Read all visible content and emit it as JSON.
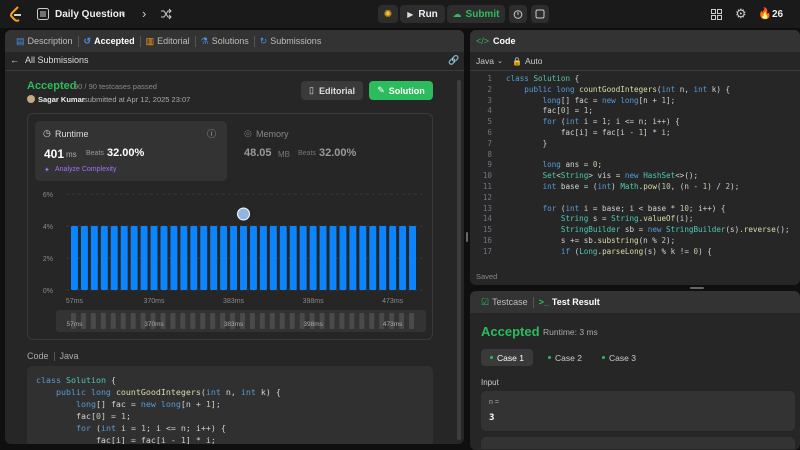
{
  "nav": {
    "title": "Daily Question",
    "run": "Run",
    "submit": "Submit",
    "streak": "26"
  },
  "left": {
    "tabs": [
      "Description",
      "Accepted",
      "Editorial",
      "Solutions",
      "Submissions"
    ],
    "all_submissions": "All Submissions",
    "status": "Accepted",
    "passed": "90 / 90 testcases passed",
    "user": "Sagar Kumar",
    "submitted": "submitted at Apr 12, 2025 23:07",
    "editorial_btn": "Editorial",
    "solution_btn": "Solution",
    "runtime_label": "Runtime",
    "runtime_value": "401",
    "runtime_unit": "ms",
    "runtime_beats_label": "Beats",
    "runtime_beats": "32.00%",
    "analyze": "Analyze Complexity",
    "memory_label": "Memory",
    "memory_value": "48.05",
    "memory_unit": "MB",
    "memory_beats_label": "Beats",
    "memory_beats": "32.00%",
    "code_label": "Code",
    "lang_label": "Java"
  },
  "chart_data": {
    "type": "bar",
    "y_ticks": [
      "6%",
      "4%",
      "2%",
      "0%"
    ],
    "ylim": [
      0,
      6
    ],
    "x_ticks": [
      "57ms",
      "370ms",
      "383ms",
      "398ms",
      "473ms"
    ],
    "values": [
      4,
      4,
      4,
      4,
      4,
      4,
      4,
      4,
      4,
      4,
      4,
      4,
      4,
      4,
      4,
      4,
      4,
      4,
      4,
      4,
      4,
      4,
      4,
      4,
      4,
      4,
      4,
      4,
      4,
      4,
      4,
      4,
      4,
      4,
      4
    ],
    "highlight_index": 17
  },
  "left_code": [
    [
      [
        "kw",
        "class "
      ],
      [
        "ty",
        "Solution"
      ],
      [
        "pl",
        " {"
      ]
    ],
    [
      [
        "pl",
        "    "
      ],
      [
        "kw",
        "public long "
      ],
      [
        "fn",
        "countGoodIntegers"
      ],
      [
        "pl",
        "("
      ],
      [
        "kw",
        "int"
      ],
      [
        "pl",
        " n, "
      ],
      [
        "kw",
        "int"
      ],
      [
        "pl",
        " k) {"
      ]
    ],
    [
      [
        "pl",
        "        "
      ],
      [
        "kw",
        "long"
      ],
      [
        "pl",
        "[] fac = "
      ],
      [
        "kw",
        "new long"
      ],
      [
        "pl",
        "[n + "
      ],
      [
        "num",
        "1"
      ],
      [
        "pl",
        "];"
      ]
    ],
    [
      [
        "pl",
        "        fac["
      ],
      [
        "num",
        "0"
      ],
      [
        "pl",
        "] = "
      ],
      [
        "num",
        "1"
      ],
      [
        "pl",
        ";"
      ]
    ],
    [
      [
        "pl",
        "        "
      ],
      [
        "kw",
        "for"
      ],
      [
        "pl",
        " ("
      ],
      [
        "kw",
        "int"
      ],
      [
        "pl",
        " i = "
      ],
      [
        "num",
        "1"
      ],
      [
        "pl",
        "; i <= n; i++) {"
      ]
    ],
    [
      [
        "pl",
        "            fac[i] = fac[i - "
      ],
      [
        "num",
        "1"
      ],
      [
        "pl",
        "] * i;"
      ]
    ]
  ],
  "right": {
    "code_title": "Code",
    "lang": "Java",
    "auto": "Auto",
    "saved": "Saved",
    "testcase_tab": "Testcase",
    "result_tab": "Test Result",
    "result_status": "Accepted",
    "result_runtime": "Runtime: 3 ms",
    "cases": [
      "Case 1",
      "Case 2",
      "Case 3"
    ],
    "input_label": "Input",
    "var_label": "n =",
    "var_value": "3"
  },
  "editor": [
    {
      "n": "1",
      "t": [
        [
          "kw",
          "class "
        ],
        [
          "ty",
          "Solution"
        ],
        [
          "pl",
          " {"
        ]
      ]
    },
    {
      "n": "2",
      "t": [
        [
          "pl",
          "    "
        ],
        [
          "kw",
          "public long "
        ],
        [
          "fn",
          "countGoodIntegers"
        ],
        [
          "pl",
          "("
        ],
        [
          "kw",
          "int"
        ],
        [
          "pl",
          " n, "
        ],
        [
          "kw",
          "int"
        ],
        [
          "pl",
          " k) {"
        ]
      ]
    },
    {
      "n": "3",
      "t": [
        [
          "pl",
          "        "
        ],
        [
          "kw",
          "long"
        ],
        [
          "pl",
          "[] fac = "
        ],
        [
          "kw",
          "new long"
        ],
        [
          "pl",
          "[n + "
        ],
        [
          "num",
          "1"
        ],
        [
          "pl",
          "];"
        ]
      ]
    },
    {
      "n": "4",
      "t": [
        [
          "pl",
          "        fac["
        ],
        [
          "num",
          "0"
        ],
        [
          "pl",
          "] = "
        ],
        [
          "num",
          "1"
        ],
        [
          "pl",
          ";"
        ]
      ]
    },
    {
      "n": "5",
      "t": [
        [
          "pl",
          "        "
        ],
        [
          "kw",
          "for"
        ],
        [
          "pl",
          " ("
        ],
        [
          "kw",
          "int"
        ],
        [
          "pl",
          " i = "
        ],
        [
          "num",
          "1"
        ],
        [
          "pl",
          "; i <= n; i++) {"
        ]
      ]
    },
    {
      "n": "6",
      "t": [
        [
          "pl",
          "            fac[i] = fac[i - "
        ],
        [
          "num",
          "1"
        ],
        [
          "pl",
          "] * i;"
        ]
      ]
    },
    {
      "n": "7",
      "t": [
        [
          "pl",
          "        }"
        ]
      ]
    },
    {
      "n": "8",
      "t": []
    },
    {
      "n": "9",
      "t": [
        [
          "pl",
          "        "
        ],
        [
          "kw",
          "long"
        ],
        [
          "pl",
          " ans = "
        ],
        [
          "num",
          "0"
        ],
        [
          "pl",
          ";"
        ]
      ]
    },
    {
      "n": "10",
      "t": [
        [
          "pl",
          "        "
        ],
        [
          "ty",
          "Set"
        ],
        [
          "pl",
          "<"
        ],
        [
          "ty",
          "String"
        ],
        [
          "pl",
          "> vis = "
        ],
        [
          "kw",
          "new "
        ],
        [
          "ty",
          "HashSet"
        ],
        [
          "pl",
          "<>();"
        ]
      ]
    },
    {
      "n": "11",
      "t": [
        [
          "pl",
          "        "
        ],
        [
          "kw",
          "int"
        ],
        [
          "pl",
          " base = ("
        ],
        [
          "kw",
          "int"
        ],
        [
          "pl",
          ") "
        ],
        [
          "ty",
          "Math"
        ],
        [
          "pl",
          "."
        ],
        [
          "fn",
          "pow"
        ],
        [
          "pl",
          "("
        ],
        [
          "num",
          "10"
        ],
        [
          "pl",
          ", (n - "
        ],
        [
          "num",
          "1"
        ],
        [
          "pl",
          ") / "
        ],
        [
          "num",
          "2"
        ],
        [
          "pl",
          ");"
        ]
      ]
    },
    {
      "n": "12",
      "t": []
    },
    {
      "n": "13",
      "t": [
        [
          "pl",
          "        "
        ],
        [
          "kw",
          "for"
        ],
        [
          "pl",
          " ("
        ],
        [
          "kw",
          "int"
        ],
        [
          "pl",
          " i = base; i < base * "
        ],
        [
          "num",
          "10"
        ],
        [
          "pl",
          "; i++) {"
        ]
      ]
    },
    {
      "n": "14",
      "t": [
        [
          "pl",
          "            "
        ],
        [
          "ty",
          "String"
        ],
        [
          "pl",
          " s = "
        ],
        [
          "ty",
          "String"
        ],
        [
          "pl",
          "."
        ],
        [
          "fn",
          "valueOf"
        ],
        [
          "pl",
          "(i);"
        ]
      ]
    },
    {
      "n": "15",
      "t": [
        [
          "pl",
          "            "
        ],
        [
          "ty",
          "StringBuilder"
        ],
        [
          "pl",
          " sb = "
        ],
        [
          "kw",
          "new "
        ],
        [
          "ty",
          "StringBuilder"
        ],
        [
          "pl",
          "(s)."
        ],
        [
          "fn",
          "reverse"
        ],
        [
          "pl",
          "();"
        ]
      ]
    },
    {
      "n": "16",
      "t": [
        [
          "pl",
          "            s += sb."
        ],
        [
          "fn",
          "substring"
        ],
        [
          "pl",
          "(n % "
        ],
        [
          "num",
          "2"
        ],
        [
          "pl",
          ");"
        ]
      ]
    },
    {
      "n": "17",
      "t": [
        [
          "pl",
          "            "
        ],
        [
          "kw",
          "if"
        ],
        [
          "pl",
          " ("
        ],
        [
          "ty",
          "Long"
        ],
        [
          "pl",
          "."
        ],
        [
          "fn",
          "parseLong"
        ],
        [
          "pl",
          "(s) % k != "
        ],
        [
          "num",
          "0"
        ],
        [
          "pl",
          ") {"
        ]
      ]
    }
  ]
}
